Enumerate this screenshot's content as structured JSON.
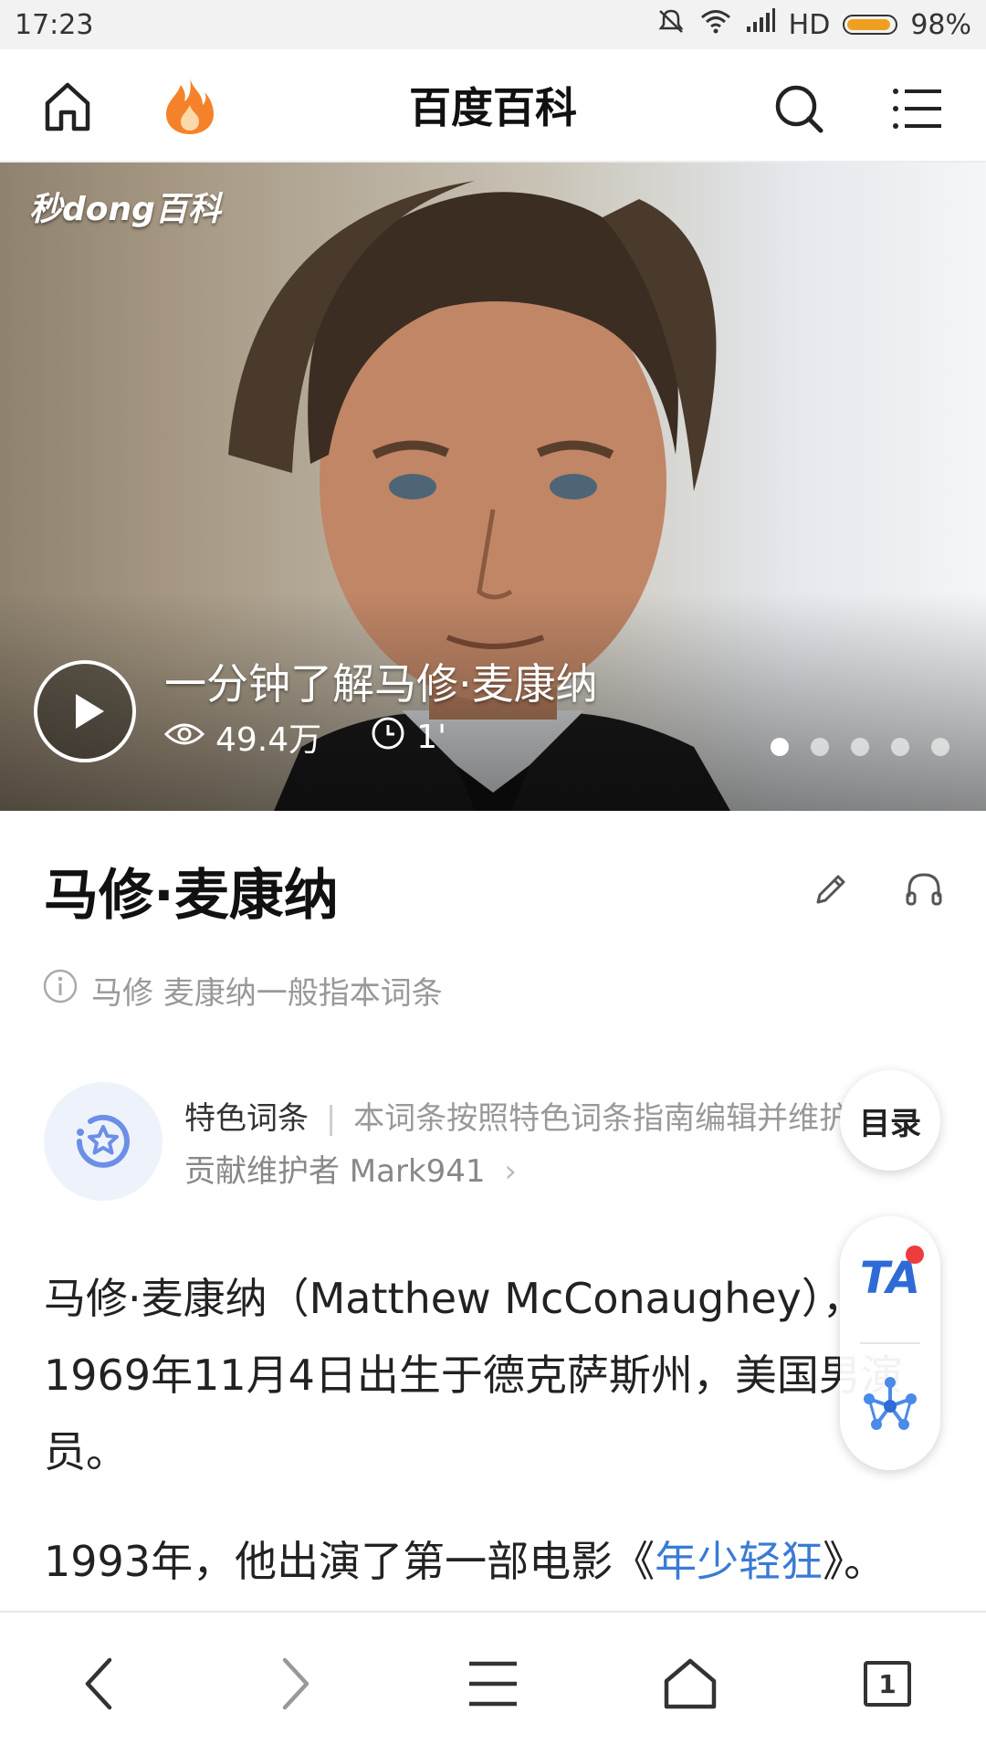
{
  "status_bar": {
    "time": "17:23",
    "network": "HD",
    "battery": "98%",
    "battery_level": 0.98
  },
  "header": {
    "title": "百度百科"
  },
  "hero": {
    "logo_text": "秒dong百科",
    "video_title": "一分钟了解马修·麦康纳",
    "views": "49.4万",
    "duration": "1'",
    "slide_count": 5,
    "active_slide": 1
  },
  "article": {
    "title": "马修·麦康纳",
    "disambiguation": "马修 麦康纳一般指本词条",
    "featured": {
      "label": "特色词条",
      "separator": "|",
      "desc": "本词条按照特色词条指南编辑并维护",
      "maintainer": "贡献维护者 Mark941",
      "chevron": "›"
    },
    "para1": "马修·麦康纳（Matthew McConaughey），1969年11月4日出生于德克萨斯州，美国男演员。",
    "para2_prefix": "1993年，他出演了第一部电影《",
    "para2_link": "年少轻狂",
    "para2_suffix": "》。"
  },
  "floating": {
    "toc_label": "目录",
    "ta_label": "TA"
  },
  "bottom_nav": {
    "tab_count": "1"
  },
  "colors": {
    "accent_blue": "#3a7bd5",
    "fire_orange": "#f5822a",
    "battery_orange": "#f0a020"
  }
}
